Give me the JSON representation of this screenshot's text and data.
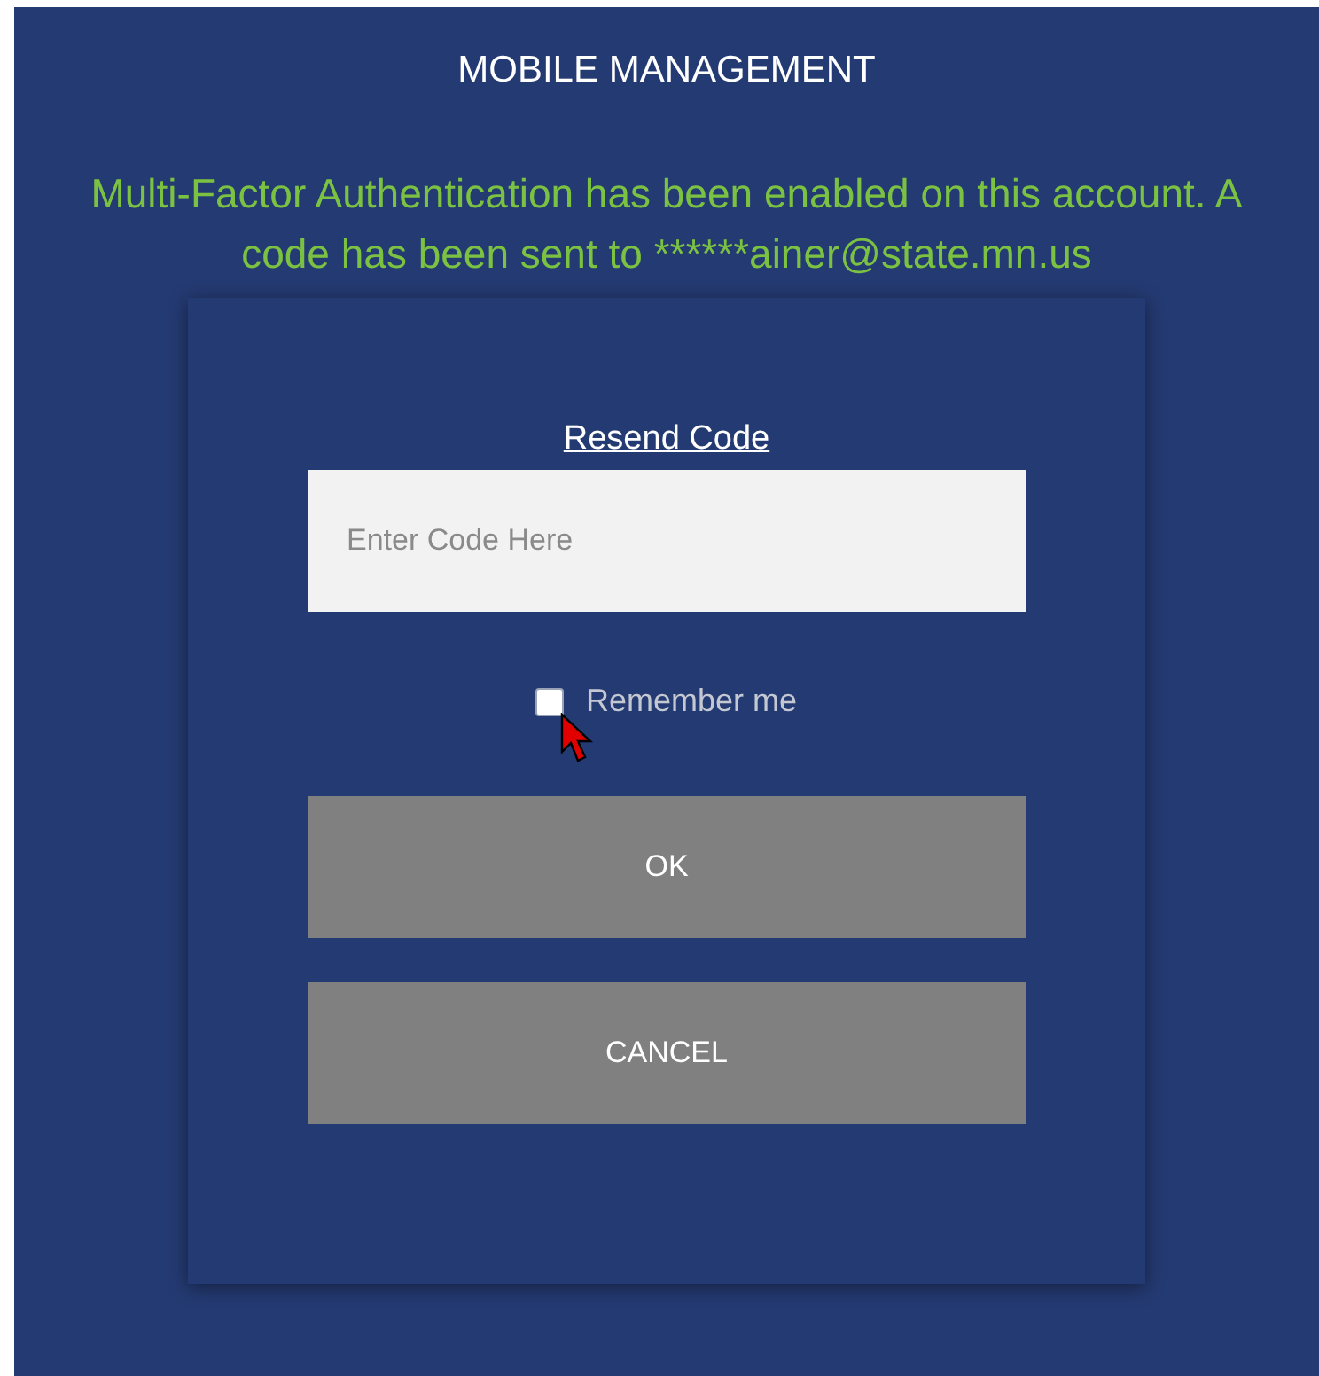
{
  "header": {
    "title": "MOBILE MANAGEMENT"
  },
  "message": "Multi-Factor Authentication has been enabled on this account. A code has been sent to ******ainer@state.mn.us",
  "resend_link": "Resend Code",
  "code_field": {
    "placeholder": "Enter Code Here"
  },
  "remember": {
    "label": "Remember me",
    "checked": false
  },
  "buttons": [
    {
      "label": "OK"
    },
    {
      "label": "CANCEL"
    }
  ]
}
